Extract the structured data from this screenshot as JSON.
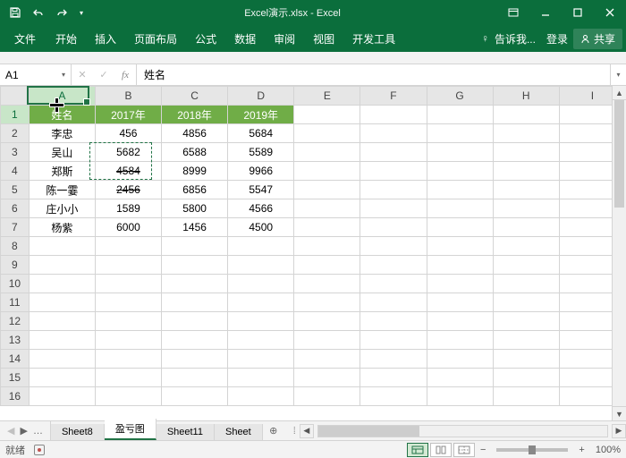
{
  "app": {
    "title": "Excel演示.xlsx - Excel"
  },
  "ribbon": {
    "file": "文件",
    "tabs": [
      "开始",
      "插入",
      "页面布局",
      "公式",
      "数据",
      "审阅",
      "视图",
      "开发工具"
    ],
    "tell_me": "告诉我...",
    "signin": "登录",
    "share": "共享"
  },
  "formula_bar": {
    "name_box": "A1",
    "fx_label": "fx",
    "value": "姓名"
  },
  "columns": [
    "A",
    "B",
    "C",
    "D",
    "E",
    "F",
    "G",
    "H",
    "I"
  ],
  "rows": [
    1,
    2,
    3,
    4,
    5,
    6,
    7,
    8,
    9,
    10,
    11,
    12,
    13,
    14,
    15,
    16
  ],
  "header_row": [
    "姓名",
    "2017年",
    "2018年",
    "2019年"
  ],
  "data_rows": [
    {
      "name": "李忠",
      "v": [
        "456",
        "4856",
        "5684"
      ]
    },
    {
      "name": "吴山",
      "v": [
        "5682",
        "6588",
        "5589"
      ]
    },
    {
      "name": "郑斯",
      "v": [
        "4584",
        "8999",
        "9966"
      ]
    },
    {
      "name": "陈一霎",
      "v": [
        "2456",
        "6856",
        "5547"
      ]
    },
    {
      "name": "庄小小",
      "v": [
        "1589",
        "5800",
        "4566"
      ]
    },
    {
      "name": "杨紫",
      "v": [
        "6000",
        "1456",
        "4500"
      ]
    }
  ],
  "strike_cells": [
    "B4",
    "B5"
  ],
  "sheet_tabs": {
    "items": [
      "Sheet8",
      "盈亏图",
      "Sheet11",
      "Sheet"
    ],
    "active": 1,
    "overflow": "…"
  },
  "statusbar": {
    "ready": "就绪",
    "zoom": "100%"
  }
}
